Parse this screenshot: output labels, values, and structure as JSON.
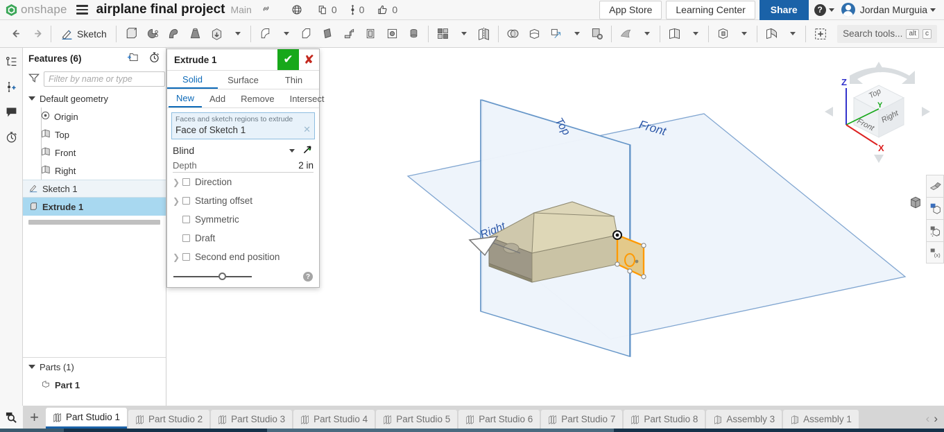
{
  "header": {
    "brand": "onshape",
    "menu_icon": "hamburger-icon",
    "document_title": "airplane final project",
    "branch": "Main",
    "link_icon": "link-icon",
    "globe_icon": "globe-icon",
    "copies_count": "0",
    "versions_count": "0",
    "likes_count": "0",
    "app_store": "App Store",
    "learning_center": "Learning Center",
    "share": "Share",
    "help_label": "?",
    "user_name": "Jordan Murguia"
  },
  "toolbar": {
    "undo": "undo-icon",
    "redo": "redo-icon",
    "sketch_label": "Sketch",
    "search_placeholder": "Search tools...",
    "search_key_alt": "alt",
    "search_key_c": "c",
    "tools": [
      "extrude-icon",
      "revolve-icon",
      "sweep-icon",
      "loft-icon",
      "thicken-icon",
      "fillet-icon",
      "chamfer-icon",
      "draft-icon",
      "rib-icon",
      "shell-icon",
      "hole-icon",
      "thread-icon",
      "pattern-icon",
      "mirror-icon",
      "boolean-icon",
      "split-icon",
      "transform-icon",
      "delete-face-icon",
      "curve-icon",
      "plane-icon",
      "part-icon",
      "surface-icon",
      "variable-icon"
    ]
  },
  "left_rail": {
    "items": [
      {
        "name": "feature-list-icon"
      },
      {
        "name": "add-comment-icon"
      },
      {
        "name": "comments-icon"
      },
      {
        "name": "history-icon"
      }
    ]
  },
  "feature_tree": {
    "title": "Features (6)",
    "add_folder_icon": "add-folder-icon",
    "timer_icon": "stopwatch-icon",
    "filter_icon": "filter-icon",
    "filter_placeholder": "Filter by name or type",
    "default_geometry_label": "Default geometry",
    "nodes": [
      {
        "label": "Origin",
        "icon": "origin-icon"
      },
      {
        "label": "Top",
        "icon": "plane-icon"
      },
      {
        "label": "Front",
        "icon": "plane-icon"
      },
      {
        "label": "Right",
        "icon": "plane-icon"
      }
    ],
    "features": [
      {
        "label": "Sketch 1",
        "icon": "sketch-icon",
        "state": "highlighted"
      },
      {
        "label": "Extrude 1",
        "icon": "extrude-icon",
        "state": "selected"
      }
    ],
    "parts_title": "Parts (1)",
    "parts": [
      {
        "label": "Part 1",
        "icon": "part-icon"
      }
    ]
  },
  "extrude_dialog": {
    "title": "Extrude 1",
    "accept_icon": "checkmark-icon",
    "cancel_icon": "close-icon",
    "type_tabs": [
      {
        "label": "Solid",
        "active": true
      },
      {
        "label": "Surface",
        "active": false
      },
      {
        "label": "Thin",
        "active": false
      }
    ],
    "op_tabs": [
      {
        "label": "New",
        "active": true
      },
      {
        "label": "Add",
        "active": false
      },
      {
        "label": "Remove",
        "active": false
      },
      {
        "label": "Intersect",
        "active": false
      }
    ],
    "selection_hint": "Faces and sketch regions to extrude",
    "selection_value": "Face of Sketch 1",
    "selection_remove_icon": "close-icon",
    "end_type": "Blind",
    "flip_icon": "flip-direction-icon",
    "depth_label": "Depth",
    "depth_value": "2 in",
    "options": [
      {
        "label": "Direction",
        "expandable": true,
        "checked": false
      },
      {
        "label": "Starting offset",
        "expandable": true,
        "checked": false
      },
      {
        "label": "Symmetric",
        "expandable": false,
        "checked": false
      },
      {
        "label": "Draft",
        "expandable": false,
        "checked": false
      },
      {
        "label": "Second end position",
        "expandable": true,
        "checked": false
      }
    ],
    "help_icon": "question-icon"
  },
  "viewport": {
    "plane_labels": {
      "front": "Front",
      "top": "Top",
      "right": "Right"
    },
    "view_cube": {
      "top": "Top",
      "front": "Front",
      "right": "Right",
      "axis_z": "Z",
      "axis_y": "Y",
      "axis_x": "X",
      "z_color": "#3333cc",
      "y_color": "#17a81a",
      "x_color": "#dd2222"
    },
    "display_style_icon": "shaded-cube-icon",
    "right_tools": [
      "section-view-icon",
      "measure-grid-icon",
      "rotate-grid-icon",
      "variable-grid-icon"
    ],
    "colors": {
      "plane_fill": "#eef4fb",
      "plane_stroke": "#6f9ed0",
      "solid_fill": "#d7cda1",
      "solid_shadow": "#9e977c",
      "selection_orange": "#ff9900"
    }
  },
  "tabbar": {
    "zoom_icon": "zoom-tab-icon",
    "add_tab_icon": "plus-icon",
    "tabs": [
      {
        "label": "Part Studio 1",
        "icon": "part-studio-icon",
        "active": true
      },
      {
        "label": "Part Studio 2",
        "icon": "part-studio-icon",
        "active": false
      },
      {
        "label": "Part Studio 3",
        "icon": "part-studio-icon",
        "active": false
      },
      {
        "label": "Part Studio 4",
        "icon": "part-studio-icon",
        "active": false
      },
      {
        "label": "Part Studio 5",
        "icon": "part-studio-icon",
        "active": false
      },
      {
        "label": "Part Studio 6",
        "icon": "part-studio-icon",
        "active": false
      },
      {
        "label": "Part Studio 7",
        "icon": "part-studio-icon",
        "active": false
      },
      {
        "label": "Part Studio 8",
        "icon": "part-studio-icon",
        "active": false
      },
      {
        "label": "Assembly 3",
        "icon": "assembly-icon",
        "active": false
      },
      {
        "label": "Assembly 1",
        "icon": "assembly-icon",
        "active": false
      }
    ],
    "prev_arrow": "‹",
    "next_arrow": "›"
  }
}
